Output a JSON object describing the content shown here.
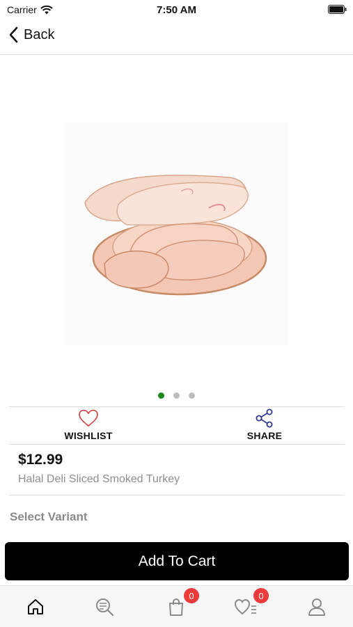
{
  "status_bar": {
    "carrier": "Carrier",
    "time": "7:50 AM"
  },
  "nav": {
    "back_label": "Back"
  },
  "carousel": {
    "slide_count": 3,
    "active_index": 0
  },
  "actions": {
    "wishlist_label": "WISHLIST",
    "share_label": "SHARE"
  },
  "product": {
    "price": "$12.99",
    "name": "Halal Deli Sliced Smoked Turkey"
  },
  "variant": {
    "heading": "Select Variant"
  },
  "cart": {
    "button_label": "Add To Cart"
  },
  "tabbar": {
    "items": [
      {
        "icon": "home-icon"
      },
      {
        "icon": "search-list-icon"
      },
      {
        "icon": "shopping-bag-icon",
        "badge": "0"
      },
      {
        "icon": "wishlist-icon",
        "badge": "0"
      },
      {
        "icon": "profile-icon"
      }
    ]
  },
  "colors": {
    "accent_green": "#1e8a1e",
    "badge_red": "#ee3a3a",
    "button_black": "#000000",
    "icon_blue": "#2e3a8c",
    "heart_red": "#d33b3b"
  }
}
